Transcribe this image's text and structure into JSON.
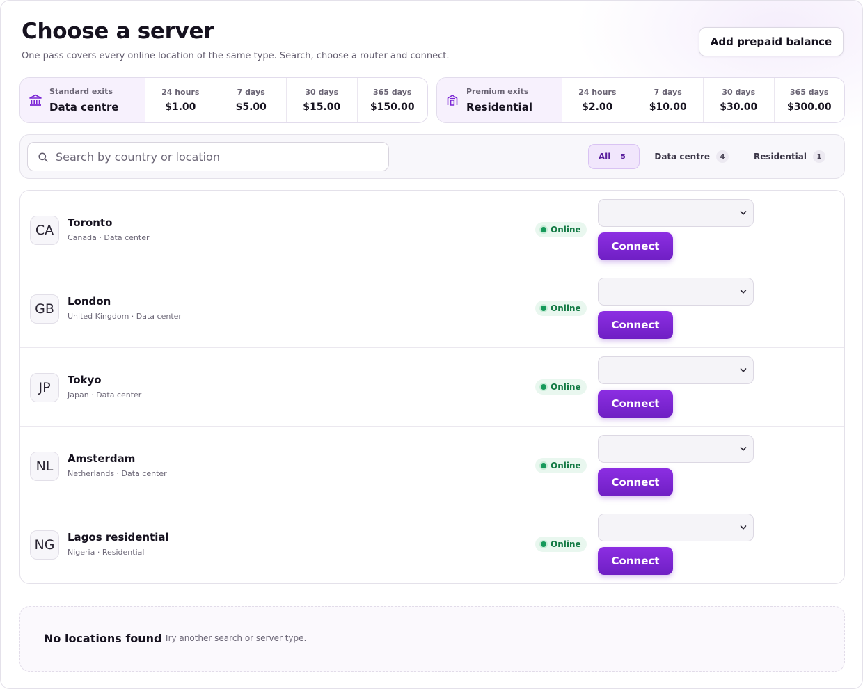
{
  "header": {
    "title": "Choose a server",
    "subtitle": "One pass covers every online location of the same type. Search, choose a router and connect.",
    "topup_label": "Add prepaid balance"
  },
  "pricing": [
    {
      "kind": "Standard exits",
      "name": "Data centre",
      "icon": "bank-icon",
      "plans": [
        {
          "duration": "24 hours",
          "price": "$1.00"
        },
        {
          "duration": "7 days",
          "price": "$5.00"
        },
        {
          "duration": "30 days",
          "price": "$15.00"
        },
        {
          "duration": "365 days",
          "price": "$150.00"
        }
      ]
    },
    {
      "kind": "Premium exits",
      "name": "Residential",
      "icon": "house-icon",
      "plans": [
        {
          "duration": "24 hours",
          "price": "$2.00"
        },
        {
          "duration": "7 days",
          "price": "$10.00"
        },
        {
          "duration": "30 days",
          "price": "$30.00"
        },
        {
          "duration": "365 days",
          "price": "$300.00"
        }
      ]
    }
  ],
  "search": {
    "placeholder": "Search by country or location",
    "value": ""
  },
  "filters": [
    {
      "label": "All",
      "count": "5",
      "active": true
    },
    {
      "label": "Data centre",
      "count": "4",
      "active": false
    },
    {
      "label": "Residential",
      "count": "1",
      "active": false
    }
  ],
  "servers": [
    {
      "code": "CA",
      "city": "Toronto",
      "meta": "Canada · Data center",
      "status": "Online",
      "router": "",
      "connect_label": "Connect"
    },
    {
      "code": "GB",
      "city": "London",
      "meta": "United Kingdom · Data center",
      "status": "Online",
      "router": "",
      "connect_label": "Connect"
    },
    {
      "code": "JP",
      "city": "Tokyo",
      "meta": "Japan · Data center",
      "status": "Online",
      "router": "",
      "connect_label": "Connect"
    },
    {
      "code": "NL",
      "city": "Amsterdam",
      "meta": "Netherlands · Data center",
      "status": "Online",
      "router": "",
      "connect_label": "Connect"
    },
    {
      "code": "NG",
      "city": "Lagos residential",
      "meta": "Nigeria · Residential",
      "status": "Online",
      "router": "",
      "connect_label": "Connect"
    }
  ],
  "empty_state": {
    "title": "No locations found",
    "hint": "Try another search or server type."
  },
  "colors": {
    "accent": "#7a25d4",
    "online": "#16995a",
    "online_bg": "#e9f7ef"
  }
}
